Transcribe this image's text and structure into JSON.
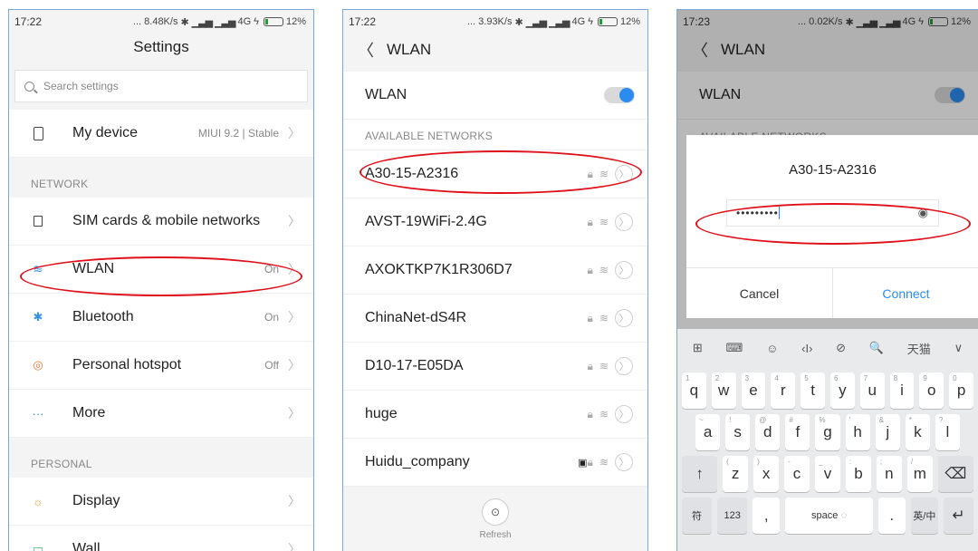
{
  "screen1": {
    "status": {
      "time": "17:22",
      "speed": "... 8.48K/s",
      "network": "4G",
      "battery": "12%"
    },
    "title": "Settings",
    "search_placeholder": "Search settings",
    "my_device": {
      "label": "My device",
      "value": "MIUI 9.2 | Stable"
    },
    "section_network": "NETWORK",
    "sim": "SIM cards & mobile networks",
    "wlan": {
      "label": "WLAN",
      "value": "On"
    },
    "bluetooth": {
      "label": "Bluetooth",
      "value": "On"
    },
    "hotspot": {
      "label": "Personal hotspot",
      "value": "Off"
    },
    "more": "More",
    "section_personal": "PERSONAL",
    "display": "Display",
    "wallpaper": "Wall..."
  },
  "screen2": {
    "status": {
      "time": "17:22",
      "speed": "... 3.93K/s",
      "network": "4G",
      "battery": "12%"
    },
    "title": "WLAN",
    "wlan_toggle_label": "WLAN",
    "section_available": "AVAILABLE NETWORKS",
    "networks": [
      "A30-15-A2316",
      "AVST-19WiFi-2.4G",
      "AXOKTKP7K1R306D7",
      "ChinaNet-dS4R",
      "D10-17-E05DA",
      "huge",
      "Huidu_company"
    ],
    "refresh": "Refresh"
  },
  "screen3": {
    "status": {
      "time": "17:23",
      "speed": "... 0.02K/s",
      "network": "4G",
      "battery": "12%"
    },
    "title": "WLAN",
    "wlan_toggle_label": "WLAN",
    "section_available": "AVAILABLE NETWORKS",
    "dialog": {
      "network": "A30-15-A2316",
      "password_mask": "•••••••••",
      "cancel": "Cancel",
      "connect": "Connect"
    },
    "keyboard": {
      "toolbar": [
        "⊞",
        "⌨",
        "☺",
        "‹I›",
        "⊘",
        "🔍",
        "天猫",
        "∨"
      ],
      "row1": [
        {
          "k": "q",
          "h": "1"
        },
        {
          "k": "w",
          "h": "2"
        },
        {
          "k": "e",
          "h": "3"
        },
        {
          "k": "r",
          "h": "4"
        },
        {
          "k": "t",
          "h": "5"
        },
        {
          "k": "y",
          "h": "6"
        },
        {
          "k": "u",
          "h": "7"
        },
        {
          "k": "i",
          "h": "8"
        },
        {
          "k": "o",
          "h": "9"
        },
        {
          "k": "p",
          "h": "0"
        }
      ],
      "row2": [
        {
          "k": "a",
          "h": "~"
        },
        {
          "k": "s",
          "h": "!"
        },
        {
          "k": "d",
          "h": "@"
        },
        {
          "k": "f",
          "h": "#"
        },
        {
          "k": "g",
          "h": "%"
        },
        {
          "k": "h",
          "h": "'"
        },
        {
          "k": "j",
          "h": "&"
        },
        {
          "k": "k",
          "h": "*"
        },
        {
          "k": "l",
          "h": "?"
        }
      ],
      "row3": [
        {
          "k": "z",
          "h": "("
        },
        {
          "k": "x",
          "h": ")"
        },
        {
          "k": "c",
          "h": "-"
        },
        {
          "k": "v",
          "h": "_"
        },
        {
          "k": "b",
          "h": ":"
        },
        {
          "k": "n",
          "h": ";"
        },
        {
          "k": "m",
          "h": "/"
        }
      ],
      "shift": "↑",
      "backspace": "⌫",
      "fu": "符",
      "num": "123",
      "comma": ",",
      "space": "space",
      "period": ".",
      "lang": "英/中",
      "enter": "↵"
    }
  }
}
